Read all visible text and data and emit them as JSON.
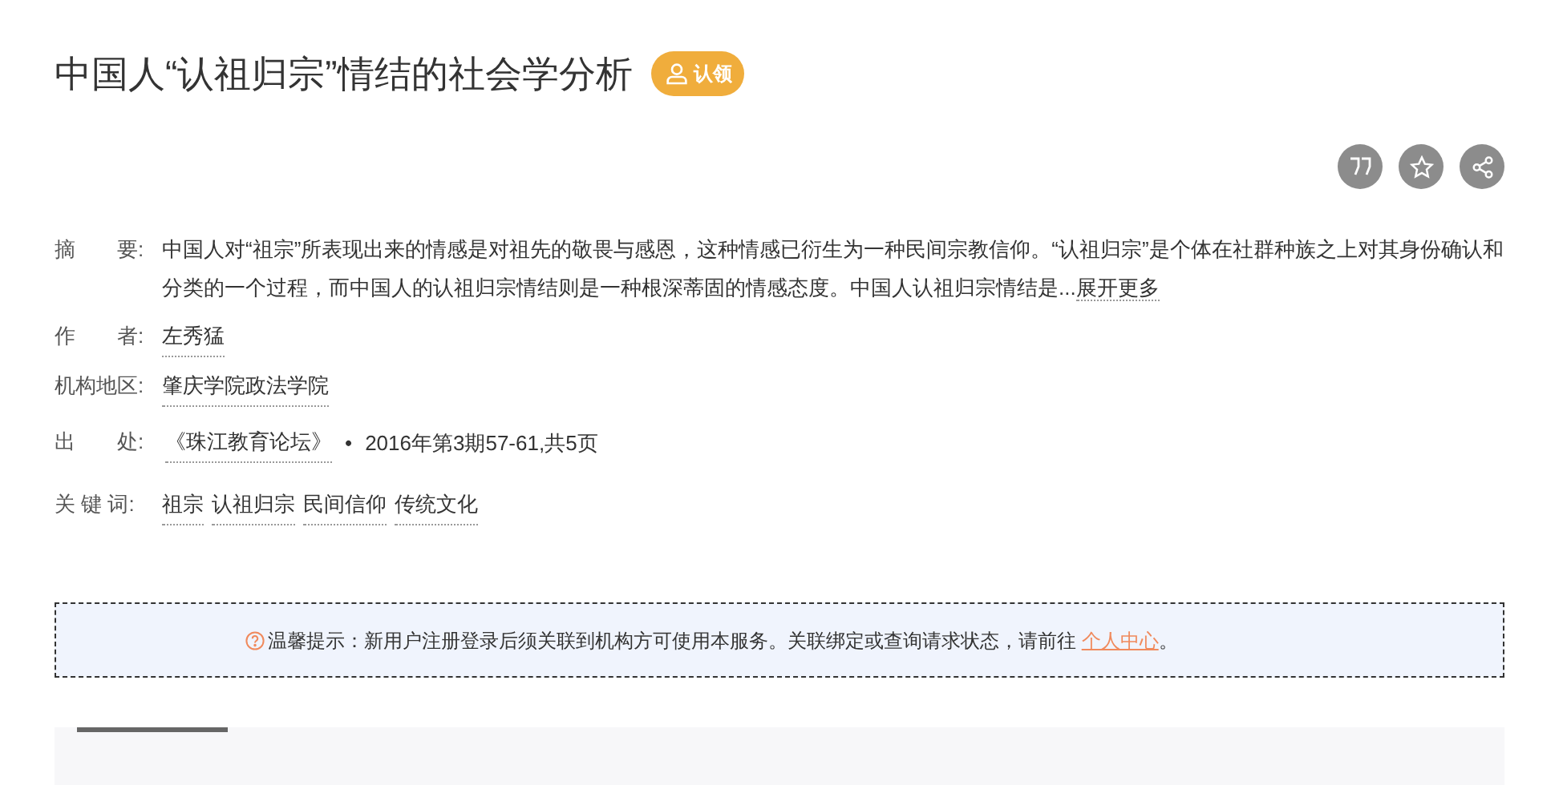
{
  "title": "中国人“认祖归宗”情结的社会学分析",
  "claim_button": "认领",
  "actions": [
    {
      "kind": "cite"
    },
    {
      "kind": "favorite"
    },
    {
      "kind": "share"
    }
  ],
  "fields": [
    {
      "label": "摘　　要:",
      "kind": "abstract",
      "text": "中国人对“祖宗”所表现出来的情感是对祖先的敬畏与感恩，这种情感已衍生为一种民间宗教信仰。“认祖归宗”是个体在社群种族之上对其身份确认和分类的一个过程，而中国人的认祖归宗情结则是一种根深蒂固的情感态度。中国人认祖归宗情结是...",
      "more": "展开更多"
    },
    {
      "label": "作　　者:",
      "kind": "links",
      "links": [
        "左秀猛"
      ]
    },
    {
      "label": "机构地区:",
      "kind": "links",
      "links": [
        "肇庆学院政法学院"
      ]
    },
    {
      "label": "出　　处:",
      "kind": "source",
      "link": "《珠江教育论坛》",
      "separator": "•",
      "detail": "2016年第3期57-61,共5页"
    },
    {
      "label": "关 键 词:",
      "kind": "links",
      "links": [
        "祖宗",
        "认祖归宗",
        "民间信仰",
        "传统文化"
      ]
    }
  ],
  "notice": {
    "prefix": "温馨提示：新用户注册登录后须关联到机构方可使用本服务。关联绑定或查询请求状态，请前往 ",
    "link": "个人中心",
    "suffix": "。"
  }
}
